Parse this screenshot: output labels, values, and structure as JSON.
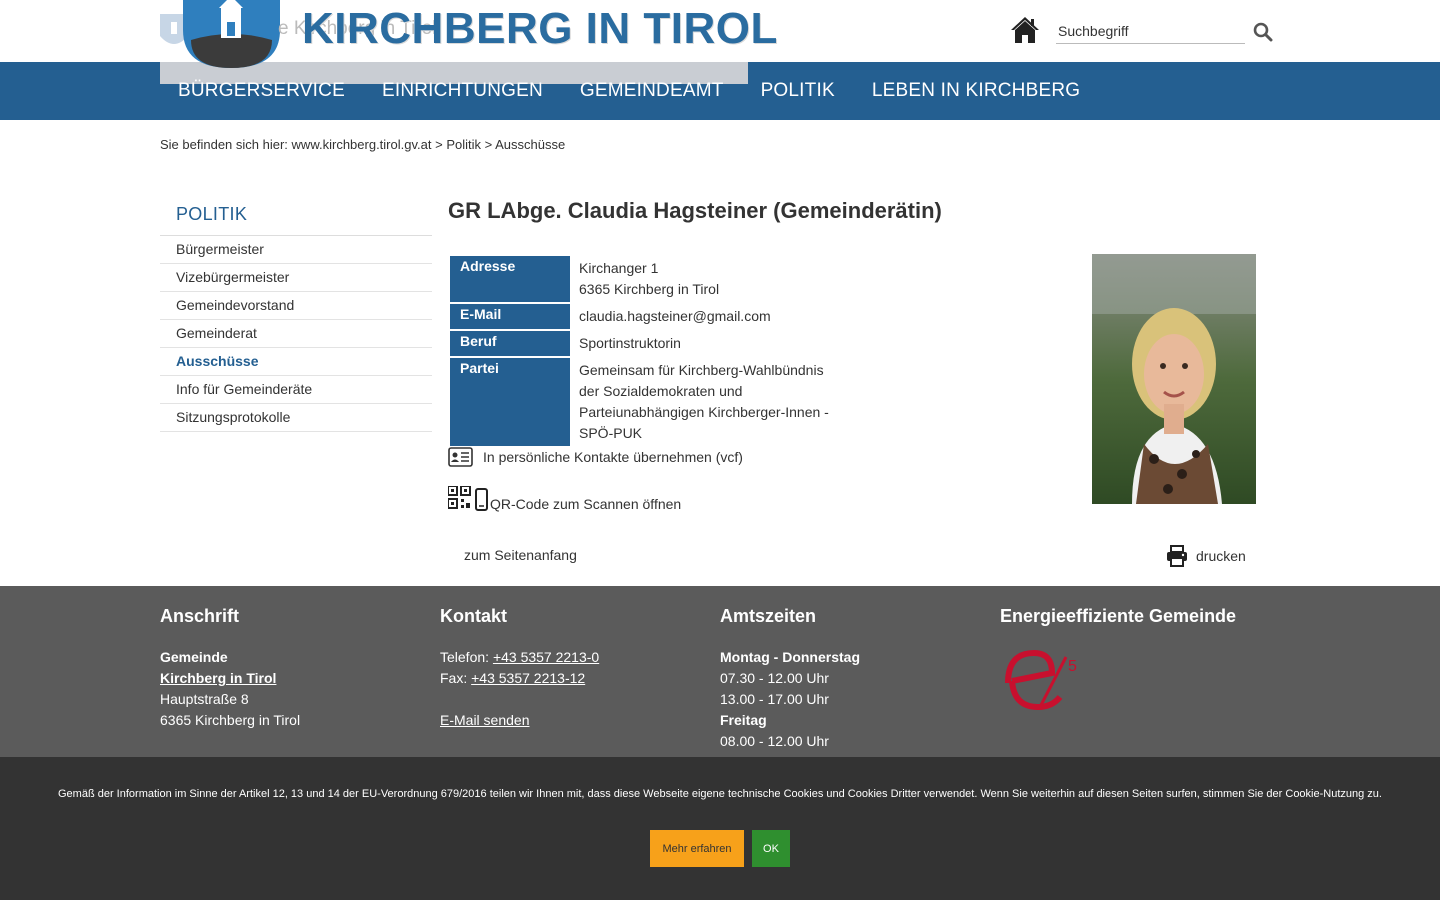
{
  "header": {
    "site_title": "KIRCHBERG IN TIROL",
    "logo_ghost_text": "e Kirchberg in Tirol",
    "search_placeholder": "Suchbegriff"
  },
  "nav": {
    "items": [
      "BÜRGERSERVICE",
      "EINRICHTUNGEN",
      "GEMEINDEAMT",
      "POLITIK",
      "LEBEN IN KIRCHBERG"
    ]
  },
  "breadcrumb": {
    "prefix": "Sie befinden sich hier:",
    "home": "www.kirchberg.tirol.gv.at",
    "sep": ">",
    "section": "Politik",
    "current": "Ausschüsse"
  },
  "sidebar": {
    "title": "POLITIK",
    "items": [
      {
        "label": "Bürgermeister",
        "active": false
      },
      {
        "label": "Vizebürgermeister",
        "active": false
      },
      {
        "label": "Gemeindevorstand",
        "active": false
      },
      {
        "label": "Gemeinderat",
        "active": false
      },
      {
        "label": "Ausschüsse",
        "active": true
      },
      {
        "label": "Info für Gemeinderäte",
        "active": false
      },
      {
        "label": "Sitzungsprotokolle",
        "active": false
      }
    ]
  },
  "person": {
    "title": "GR LAbge. Claudia Hagsteiner (Gemeinderätin)",
    "address_label": "Adresse",
    "address_line1": "Kirchanger 1",
    "address_line2": "6365 Kirchberg in Tirol",
    "email_label": "E-Mail",
    "email": "claudia.hagsteiner@gmail.com",
    "job_label": "Beruf",
    "job": "Sportinstruktorin",
    "party_label": "Partei",
    "party_line1": "Gemeinsam für Kirchberg-Wahlbündnis",
    "party_line2": "der Sozialdemokraten und",
    "party_line3": "Parteiunabhängigen Kirchberger-Innen -",
    "party_line4": "SPÖ-PUK"
  },
  "actions": {
    "vcf": "In persönliche Kontakte übernehmen (vcf)",
    "qr": "QR-Code zum Scannen öffnen",
    "to_top": "zum Seitenanfang",
    "print": "drucken"
  },
  "footer": {
    "address": {
      "heading": "Anschrift",
      "line1": "Gemeinde",
      "line2": "Kirchberg in Tirol",
      "line3": "Hauptstraße 8",
      "line4": "6365 Kirchberg in Tirol"
    },
    "contact": {
      "heading": "Kontakt",
      "phone_label": "Telefon:",
      "phone": "+43 5357 2213-0",
      "fax_label": "Fax:",
      "fax": "+43 5357 2213-12",
      "email_link": "E-Mail senden"
    },
    "hours": {
      "heading": "Amtszeiten",
      "days1": "Montag - Donnerstag",
      "time1": "07.30 - 12.00 Uhr",
      "time2": "13.00 - 17.00 Uhr",
      "days2": "Freitag",
      "time3": "08.00 - 12.00 Uhr"
    },
    "energy": {
      "heading": "Energieeffiziente Gemeinde"
    }
  },
  "cookie": {
    "text": "Gemäß der Information im Sinne der Artikel 12, 13 und 14 der EU-Verordnung 679/2016 teilen wir Ihnen mit, dass diese Webseite eigene technische Cookies und Cookies Dritter verwendet. Wenn Sie weiterhin auf diesen Seiten surfen, stimmen Sie der Cookie-Nutzung zu.",
    "more_label": "Mehr erfahren",
    "ok_label": "OK"
  },
  "colors": {
    "brand_blue": "#245f91",
    "footer_gray": "#5b5b5b",
    "cookie_orange": "#f7a11a",
    "cookie_green": "#2f8f2f"
  }
}
